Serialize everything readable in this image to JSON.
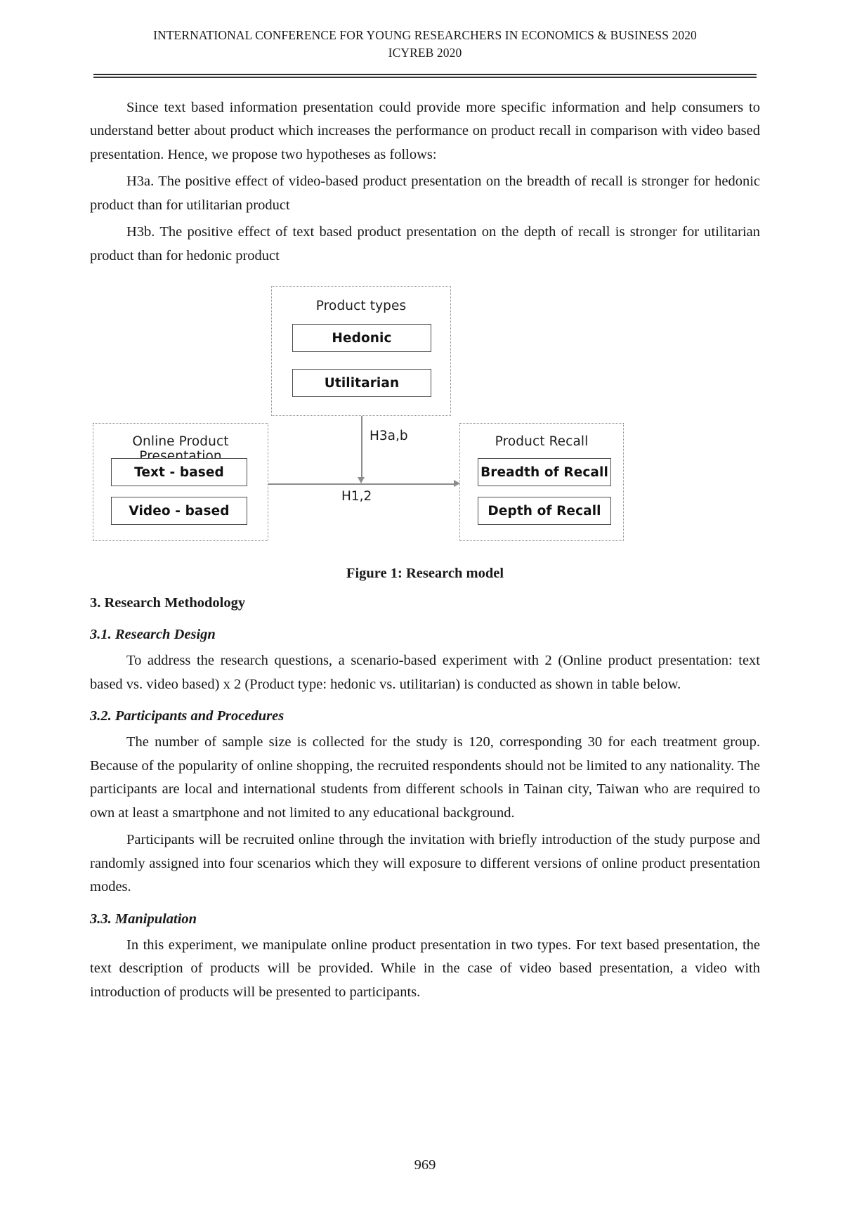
{
  "running_head": {
    "line1": "INTERNATIONAL CONFERENCE FOR YOUNG RESEARCHERS IN ECONOMICS & BUSINESS 2020",
    "line2": "ICYREB 2020"
  },
  "body": {
    "p1": "Since text based information presentation could provide more specific information and help consumers to understand better about product which increases the performance on product recall in comparison with video based presentation. Hence, we propose two hypotheses as follows:",
    "p2": "H3a. The positive effect of video-based product presentation on the breadth of recall is stronger for hedonic product than for utilitarian product",
    "p3": "H3b. The positive effect of text based product presentation on the depth of recall is stronger for utilitarian product than for hedonic product",
    "figure_caption": "Figure 1: Research model",
    "heading_3": "3. Research Methodology",
    "heading_3_1": "3.1. Research Design",
    "p4": "To address the research questions, a scenario-based experiment with 2 (Online product presentation: text based vs. video based) x 2 (Product type: hedonic vs. utilitarian) is conducted as shown in table below.",
    "heading_3_2": "3.2. Participants and Procedures",
    "p5": "The number of sample size is collected for the study is 120, corresponding 30 for each treatment group. Because of the popularity of online shopping, the recruited respondents should not be limited to any nationality. The participants are local and international students from different schools in Tainan city, Taiwan who are required to own at least a smartphone and not limited to any educational background.",
    "p6": "Participants will be recruited online through the invitation with briefly introduction of the study purpose and randomly assigned into four scenarios which they will exposure to different versions of online product presentation modes.",
    "heading_3_3": "3.3. Manipulation",
    "p7": "In this experiment, we manipulate online product presentation in two types. For text based presentation, the text description of products will be provided. While in the case of video based presentation, a video with introduction of products will be presented to participants.",
    "page_number": "969"
  },
  "figure": {
    "product_types": {
      "title": "Product types",
      "items": [
        "Hedonic",
        "Utilitarian"
      ]
    },
    "online_presentation": {
      "title": "Online Product Presentation",
      "items": [
        "Text - based",
        "Video - based"
      ]
    },
    "product_recall": {
      "title": "Product Recall",
      "items": [
        "Breadth of Recall",
        "Depth of Recall"
      ]
    },
    "edge_labels": {
      "moderation": "H3a,b",
      "main_effect": "H1,2"
    }
  }
}
